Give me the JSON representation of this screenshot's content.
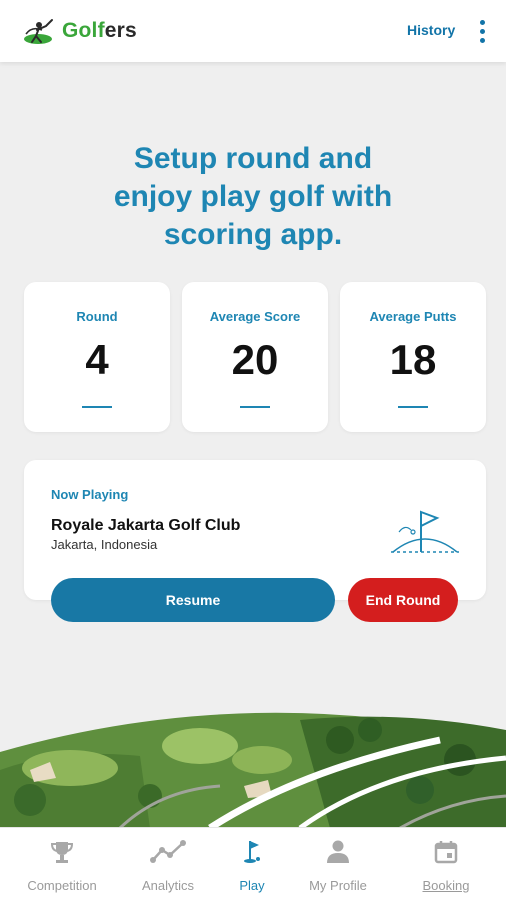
{
  "app": {
    "brand_prefix": "Golf",
    "brand_suffix": "ers",
    "history_label": "History"
  },
  "hero": {
    "line1": "Setup round and",
    "line2": "enjoy play golf with",
    "line3": "scoring app."
  },
  "stats": [
    {
      "label": "Round",
      "value": "4"
    },
    {
      "label": "Average Score",
      "value": "20"
    },
    {
      "label": "Average Putts",
      "value": "18"
    }
  ],
  "now_playing": {
    "heading": "Now Playing",
    "course": "Royale Jakarta Golf Club",
    "location": "Jakarta, Indonesia"
  },
  "actions": {
    "resume": "Resume",
    "end_round": "End Round"
  },
  "nav": [
    {
      "label": "Competition",
      "icon": "trophy-icon",
      "active": false
    },
    {
      "label": "Analytics",
      "icon": "analytics-icon",
      "active": false
    },
    {
      "label": "Play",
      "icon": "golf-flag-icon",
      "active": true
    },
    {
      "label": "My Profile",
      "icon": "person-icon",
      "active": false
    },
    {
      "label": "Booking",
      "icon": "calendar-icon",
      "active": false
    }
  ],
  "colors": {
    "primary": "#1e86b3",
    "resume_button": "#1878a5",
    "end_button": "#d41e1e",
    "background": "#efefef",
    "brand_green": "#3aa63a"
  }
}
